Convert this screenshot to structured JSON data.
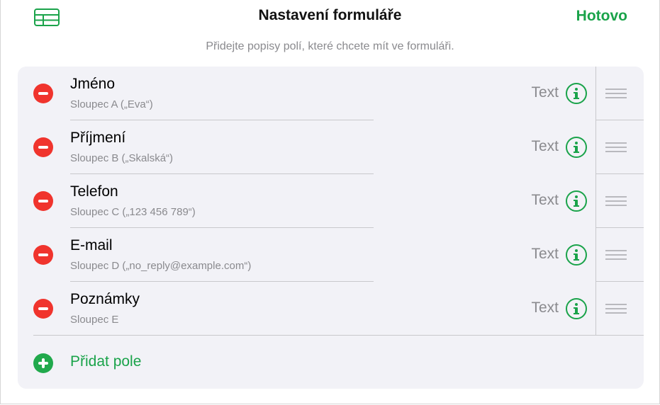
{
  "header": {
    "title": "Nastavení formuláře",
    "done_label": "Hotovo",
    "subtitle": "Přidejte popisy polí, které chcete mít ve formuláři."
  },
  "fields": [
    {
      "name": "Jméno",
      "column": "Sloupec A („Eva“)",
      "type": "Text"
    },
    {
      "name": "Příjmení",
      "column": "Sloupec B („Skalská“)",
      "type": "Text"
    },
    {
      "name": "Telefon",
      "column": "Sloupec C („123 456 789“)",
      "type": "Text"
    },
    {
      "name": "E-mail",
      "column": "Sloupec D („no_reply@example.com“)",
      "type": "Text"
    },
    {
      "name": "Poznámky",
      "column": "Sloupec E",
      "type": "Text"
    }
  ],
  "add_field": {
    "label": "Přidat pole"
  },
  "colors": {
    "accent": "#1aa34a",
    "delete": "#f0342d",
    "card_bg": "#f2f2f7",
    "secondary_text": "#8a8a8e"
  }
}
